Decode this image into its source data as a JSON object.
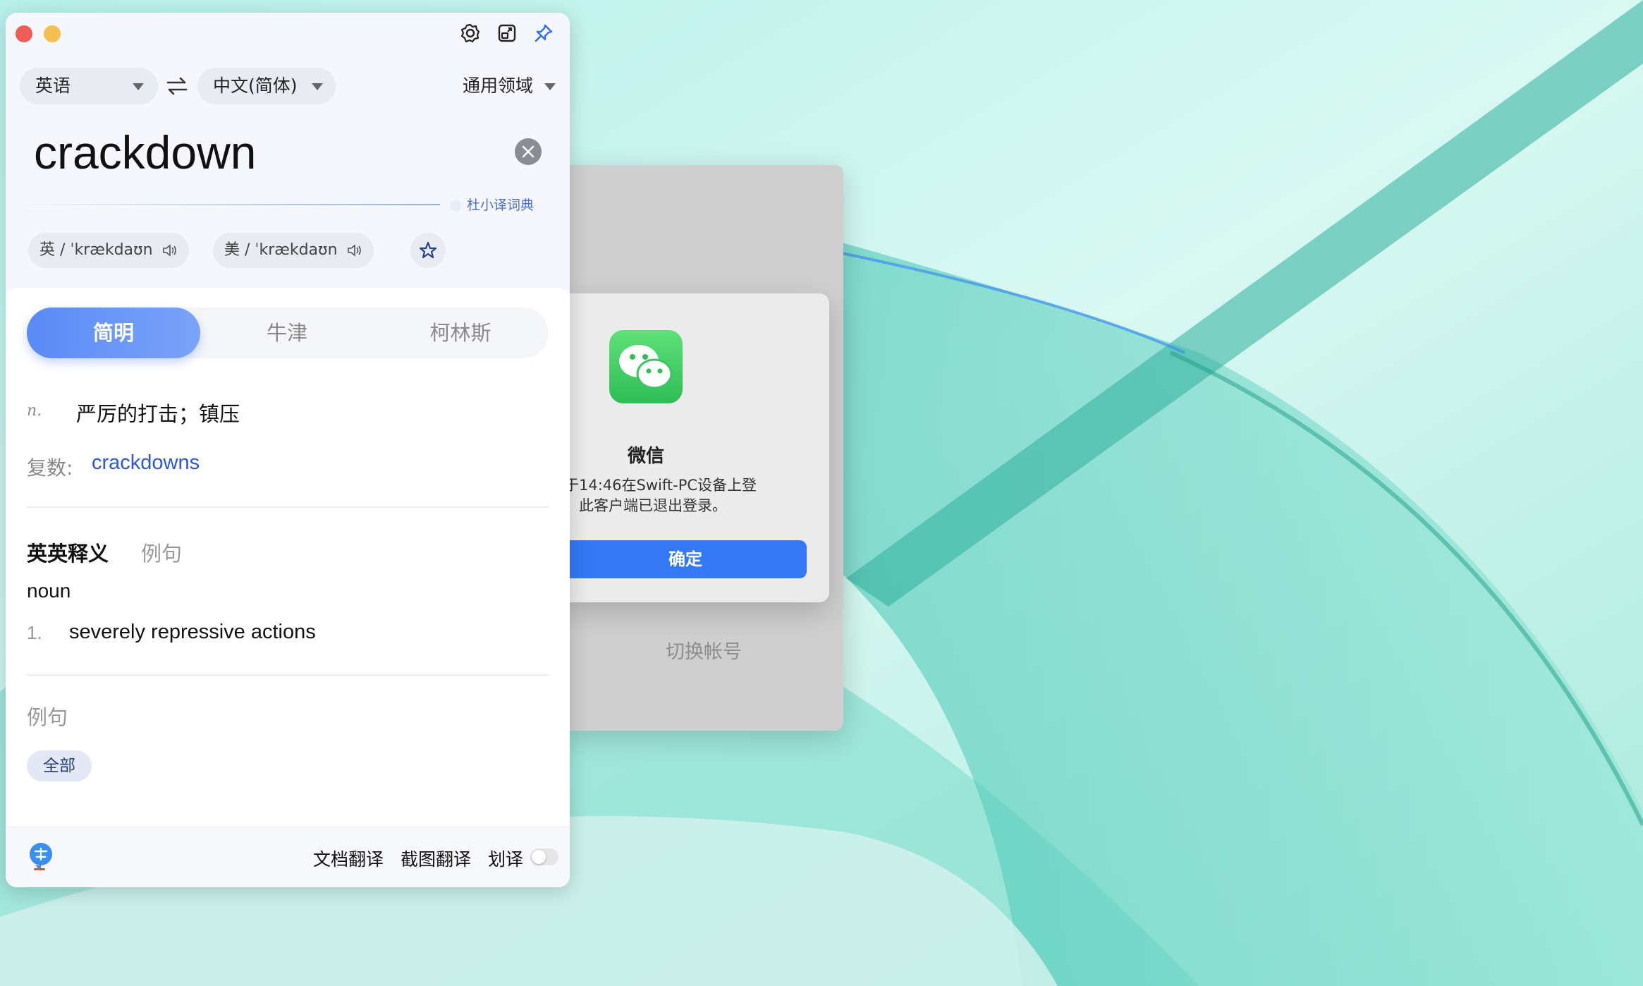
{
  "wechat": {
    "switch_account": "切换帐号",
    "alert_title": "微信",
    "alert_line1": "于14:46在Swift-PC设备上登",
    "alert_line2": "。此客户端已退出登录。",
    "ok_label": "确定"
  },
  "translator": {
    "source_lang": "英语",
    "target_lang": "中文(简体)",
    "domain": "通用领域",
    "input_text": "crackdown",
    "dict_source": "杜小译词典",
    "phonetics": [
      {
        "region": "英",
        "ipa": "/ ˈkrækdaʊn"
      },
      {
        "region": "美",
        "ipa": "/ ˈkrækdaʊn"
      }
    ],
    "tabs": [
      "简明",
      "牛津",
      "柯林斯"
    ],
    "definition": {
      "pos": "n.",
      "meaning": "严厉的打击；镇压"
    },
    "plural_label": "复数:",
    "plural_value": "crackdowns",
    "section_title": "英英释义",
    "section_tab": "例句",
    "eng_pos": "noun",
    "eng_defs": [
      {
        "num": "1.",
        "text": "severely repressive actions"
      }
    ],
    "examples_title": "例句",
    "examples_filter": "全部",
    "footer": {
      "doc": "文档翻译",
      "screenshot": "截图翻译",
      "select": "划译"
    }
  },
  "colors": {
    "accent": "#5a8af7",
    "link": "#2d58d6",
    "wechat_green": "#2fbd55"
  },
  "icons": [
    "settings-icon",
    "window-icon",
    "pin-icon",
    "swap-icon",
    "clear-icon",
    "speaker-icon",
    "star-icon",
    "app-logo-icon",
    "wechat-logo-icon"
  ]
}
